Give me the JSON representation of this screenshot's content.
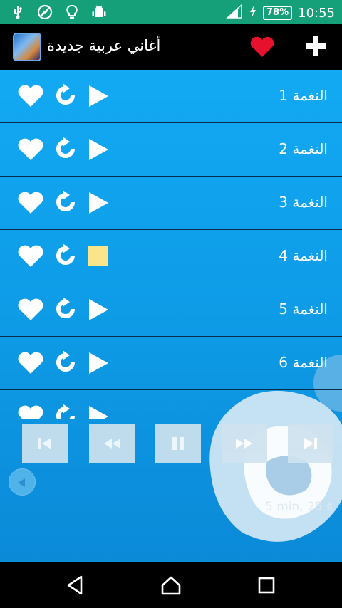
{
  "status_bar": {
    "battery": "78%",
    "time": "10:55",
    "icons": [
      "usb-icon",
      "no-image-icon",
      "bulb-icon",
      "android-icon",
      "signal-icon",
      "charging-icon",
      "battery-icon"
    ]
  },
  "app_bar": {
    "title": "أغاني عربية جديدة",
    "icons": [
      "app-logo",
      "heart-icon",
      "plus-icon"
    ],
    "colors": {
      "heart": "#e8112d",
      "background": "#000000"
    }
  },
  "tracks": [
    {
      "label": "النغمة 1",
      "state": "play"
    },
    {
      "label": "النغمة 2",
      "state": "play"
    },
    {
      "label": "النغمة 3",
      "state": "play"
    },
    {
      "label": "النغمة 4",
      "state": "stop"
    },
    {
      "label": "النغمة 5",
      "state": "play"
    },
    {
      "label": "النغمة 6",
      "state": "play"
    }
  ],
  "player": {
    "buttons": [
      "skip-previous-icon",
      "rewind-icon",
      "pause-icon",
      "fast-forward-icon",
      "skip-next-icon"
    ],
    "duration": "5 min, 25 s"
  },
  "nav_bar": {
    "icons": [
      "back-icon",
      "home-icon",
      "recents-icon"
    ]
  },
  "colors": {
    "status_bar": "#16a07a",
    "list_background": "#13a9f3",
    "stop_indicator": "#fbe48a"
  }
}
